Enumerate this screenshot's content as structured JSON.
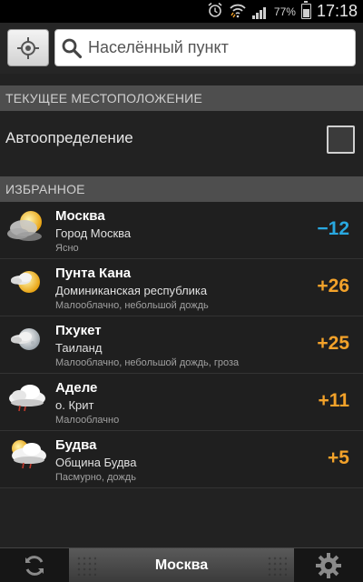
{
  "status_bar": {
    "time": "17:18",
    "battery_percent": "77%",
    "battery_level": 0.77,
    "icons": [
      "alarm-icon",
      "wifi-icon",
      "signal-icon",
      "battery-icon"
    ]
  },
  "search": {
    "locate_icon": "crosshair-icon",
    "placeholder": "Населённый пункт"
  },
  "current_location": {
    "section_title": "ТЕКУЩЕЕ МЕСТОПОЛОЖЕНИЕ",
    "auto_label": "Автоопределение",
    "auto_checked": false
  },
  "favorites": {
    "section_title": "ИЗБРАННОЕ",
    "cities": [
      {
        "name": "Москва",
        "region": "Город Москва",
        "condition": "Ясно",
        "temp": "−12",
        "temp_color": "#29a8e0",
        "icon": "night-fog-icon"
      },
      {
        "name": "Пунта Кана",
        "region": "Доминиканская республика",
        "condition": "Малооблачно, небольшой дождь",
        "temp": "+26",
        "temp_color": "#f3a22a",
        "icon": "sun-cloud-icon"
      },
      {
        "name": "Пхукет",
        "region": "Таиланд",
        "condition": "Малооблачно, небольшой дождь, гроза",
        "temp": "+25",
        "temp_color": "#f3a22a",
        "icon": "moon-cloud-icon"
      },
      {
        "name": "Аделе",
        "region": "о. Крит",
        "condition": "Малооблачно",
        "temp": "+11",
        "temp_color": "#f3a22a",
        "icon": "cloud-rain-icon"
      },
      {
        "name": "Будва",
        "region": "Община Будва",
        "condition": "Пасмурно, дождь",
        "temp": "+5",
        "temp_color": "#f3a22a",
        "icon": "sun-cloud-rain-icon"
      }
    ]
  },
  "bottom_bar": {
    "refresh_icon": "refresh-icon",
    "current_city": "Москва",
    "settings_icon": "gear-icon"
  }
}
